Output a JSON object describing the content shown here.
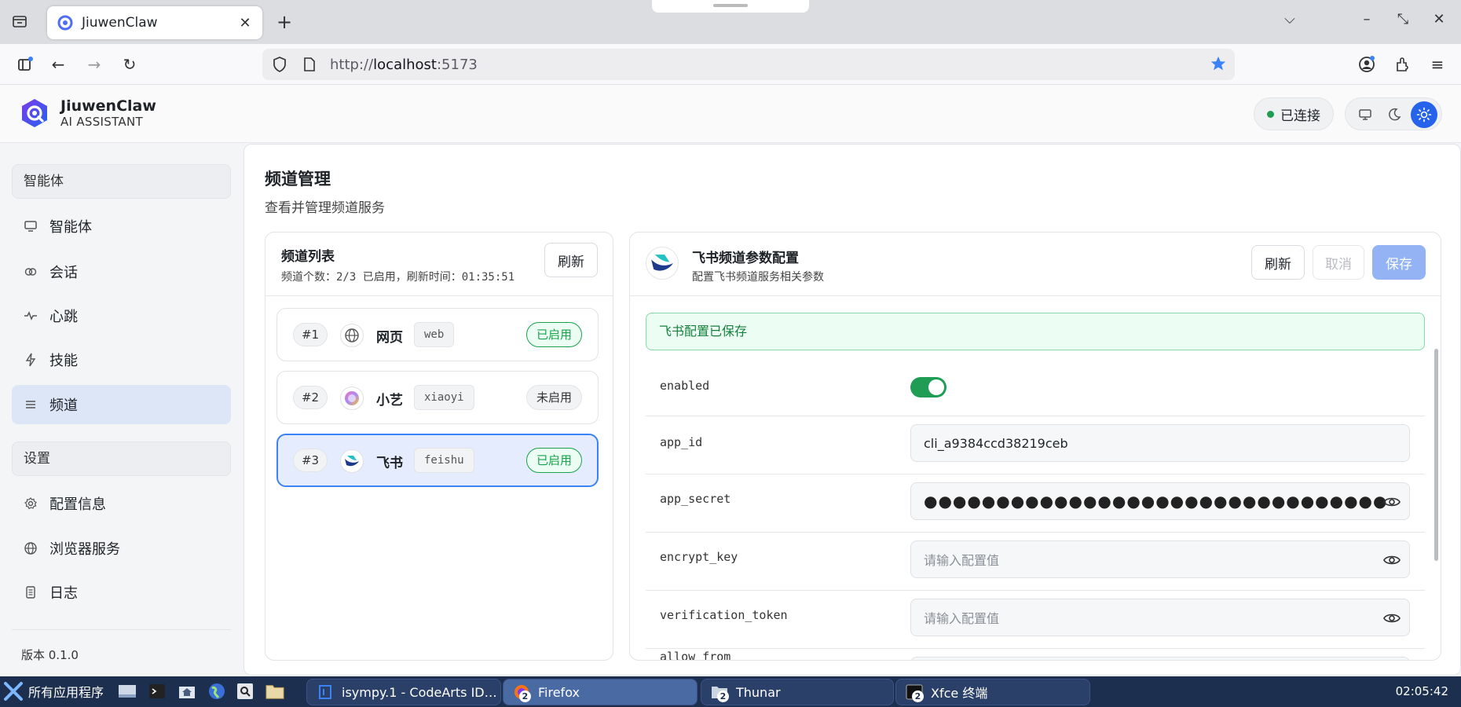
{
  "browser": {
    "tab_title": "JiuwenClaw",
    "url_prefix": "http://",
    "url_host": "localhost",
    "url_port": ":5173"
  },
  "app": {
    "brand_name": "JiuwenClaw",
    "brand_sub": "AI ASSISTANT",
    "connection_status": "已连接"
  },
  "sidebar": {
    "section_agents": "智能体",
    "items_top": [
      {
        "label": "智能体",
        "icon": "monitor-icon"
      },
      {
        "label": "会话",
        "icon": "chat-icon"
      },
      {
        "label": "心跳",
        "icon": "pulse-icon"
      },
      {
        "label": "技能",
        "icon": "bolt-icon"
      },
      {
        "label": "频道",
        "icon": "menu-icon"
      }
    ],
    "section_settings": "设置",
    "items_bottom": [
      {
        "label": "配置信息",
        "icon": "gear-icon"
      },
      {
        "label": "浏览器服务",
        "icon": "globe-icon"
      },
      {
        "label": "日志",
        "icon": "document-icon"
      }
    ],
    "version": "版本 0.1.0"
  },
  "page": {
    "title": "频道管理",
    "subtitle": "查看并管理频道服务"
  },
  "channel_list": {
    "title": "频道列表",
    "meta": "频道个数：2/3 已启用，刷新时间：01:35:51",
    "refresh_label": "刷新",
    "channels": [
      {
        "num": "#1",
        "name": "网页",
        "code": "web",
        "status": "已启用"
      },
      {
        "num": "#2",
        "name": "小艺",
        "code": "xiaoyi",
        "status": "未启用"
      },
      {
        "num": "#3",
        "name": "飞书",
        "code": "feishu",
        "status": "已启用"
      }
    ]
  },
  "config": {
    "title": "飞书频道参数配置",
    "subtitle": "配置飞书频道服务相关参数",
    "refresh_label": "刷新",
    "cancel_label": "取消",
    "save_label": "保存",
    "alert": "飞书配置已保存",
    "fields": [
      {
        "key": "enabled",
        "value": ""
      },
      {
        "key": "app_id",
        "value": "cli_a9384ccd38219ceb"
      },
      {
        "key": "app_secret",
        "value": "●●●●●●●●●●●●●●●●●●●●●●●●●●●●●●●●"
      },
      {
        "key": "encrypt_key",
        "placeholder": "请输入配置值"
      },
      {
        "key": "verification_token",
        "placeholder": "请输入配置值"
      },
      {
        "key": "allow_from",
        "value": ""
      }
    ]
  },
  "taskbar": {
    "start_label": "所有应用程序",
    "windows": [
      {
        "label": "isympy.1 - CodeArts ID…"
      },
      {
        "label": "Firefox",
        "count": "2"
      },
      {
        "label": "Thunar",
        "count": "2"
      },
      {
        "label": "Xfce 终端",
        "count": "2"
      }
    ],
    "clock": "02:05:42"
  },
  "colors": {
    "accent": "#2563eb",
    "success": "#16a34a",
    "taskbar": "#1d2f4f"
  }
}
